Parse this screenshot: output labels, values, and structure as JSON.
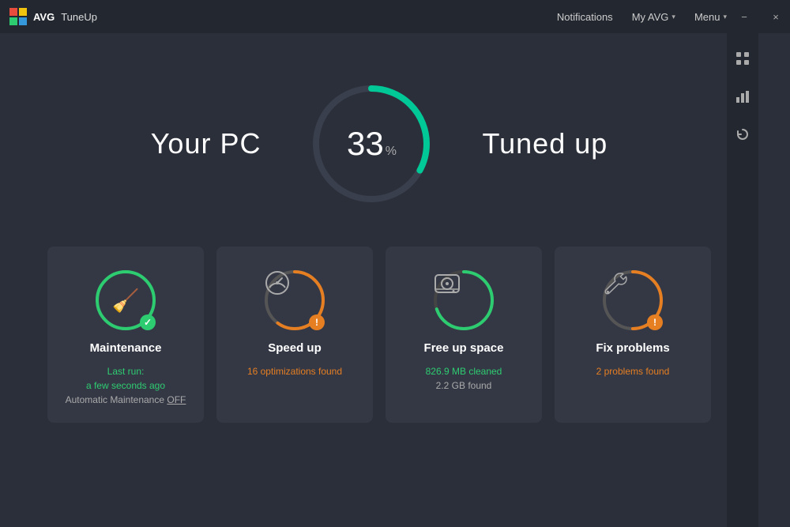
{
  "titlebar": {
    "app_name": "TuneUp",
    "avg_prefix": "AVG",
    "nav": {
      "notifications": "Notifications",
      "my_avg": "My AVG",
      "menu": "Menu"
    },
    "controls": {
      "minimize": "−",
      "close": "×"
    }
  },
  "score": {
    "left_label": "Your PC",
    "right_label": "Tuned up",
    "value": "33",
    "percent_sign": "%",
    "progress": 33
  },
  "sidebar": {
    "icons": [
      "grid",
      "bar-chart",
      "refresh"
    ]
  },
  "cards": [
    {
      "id": "maintenance",
      "title": "Maintenance",
      "ring_color": "#2ecc71",
      "ring_track_color": "#2ecc71",
      "ring_percent": 100,
      "badge_type": "check",
      "icon": "🧹",
      "subtitle_line1": "Last run:",
      "subtitle_line1_class": "highlight-green",
      "subtitle_line2": "a few seconds ago",
      "subtitle_line2_class": "highlight-green",
      "subtitle_line3": "Automatic Maintenance ",
      "subtitle_line3_suffix": "OFF",
      "subtitle_line3_suffix_class": "underline"
    },
    {
      "id": "speed-up",
      "title": "Speed up",
      "ring_color": "#e67e22",
      "ring_track_color": "#555",
      "ring_percent": 60,
      "badge_type": "warn",
      "icon": "⚡",
      "subtitle_line1": "16 optimizations found",
      "subtitle_line1_class": "highlight-orange"
    },
    {
      "id": "free-space",
      "title": "Free up space",
      "ring_color": "#2ecc71",
      "ring_track_color": "#555",
      "ring_percent": 70,
      "badge_type": "none",
      "icon": "💿",
      "subtitle_line1": "826.9 MB cleaned",
      "subtitle_line1_class": "highlight-green",
      "subtitle_line2": "2.2 GB found",
      "subtitle_line2_class": ""
    },
    {
      "id": "fix-problems",
      "title": "Fix problems",
      "ring_color": "#e67e22",
      "ring_track_color": "#555",
      "ring_percent": 50,
      "badge_type": "warn",
      "icon": "🔧",
      "subtitle_line1": "2 problems found",
      "subtitle_line1_class": "highlight-orange"
    }
  ]
}
